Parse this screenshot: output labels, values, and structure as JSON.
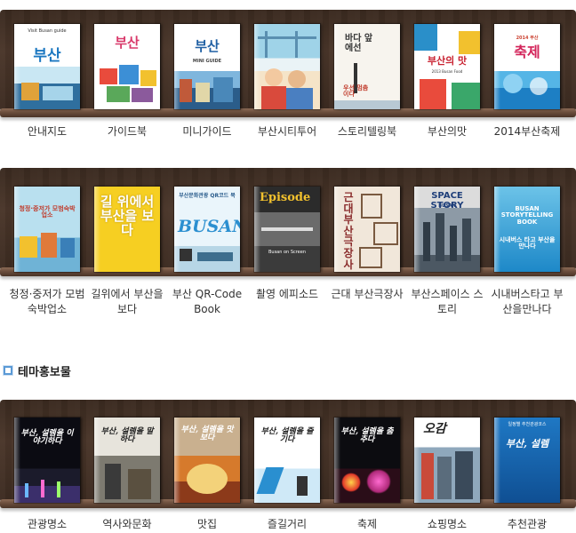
{
  "shelves": [
    {
      "books": [
        {
          "caption": "안내지도",
          "cover_title": "부산",
          "cover_small": "Visit Busan guide"
        },
        {
          "caption": "가이드북",
          "cover_title": "부산",
          "cover_small": "SOUL BUSAN"
        },
        {
          "caption": "미니가이드",
          "cover_title": "부산",
          "cover_small": "MINI GUIDE"
        },
        {
          "caption": "부산시티투어",
          "cover_title": "",
          "cover_small": ""
        },
        {
          "caption": "스토리텔링북",
          "cover_title": "바다 앞에선",
          "cover_small": "우선 멈춤이다"
        },
        {
          "caption": "부산의맛",
          "cover_title": "부산의 맛",
          "cover_small": "2013 Busan Food"
        },
        {
          "caption": "2014부산축제",
          "cover_title": "축제",
          "cover_small": "2014 부산"
        }
      ]
    },
    {
      "books": [
        {
          "caption": "청정·중저가 모범 숙박업소",
          "cover_title": "청정·중저가 모범숙박업소",
          "cover_small": ""
        },
        {
          "caption": "길위에서 부산을보다",
          "cover_title": "길 위에서 부산을 보다",
          "cover_small": ""
        },
        {
          "caption": "부산 QR-Code Book",
          "cover_title": "BUSAN",
          "cover_small": "부산문화관광 QR코드 북"
        },
        {
          "caption": "촬영 에피소드",
          "cover_title": "Episode",
          "cover_small": "Busan on Screen"
        },
        {
          "caption": "근대 부산극장사",
          "cover_title": "근대 부산극장사",
          "cover_small": ""
        },
        {
          "caption": "부산스페이스 스토리",
          "cover_title": "SPACE STORY",
          "cover_small": "BUSAN"
        },
        {
          "caption": "시내버스타고 부산을만나다",
          "cover_title": "BUSAN STORYTELLING BOOK",
          "cover_small": "시내버스 타고 부산을 만나다"
        }
      ]
    },
    {
      "books": [
        {
          "caption": "관광명소",
          "cover_title": "부산, 설렘을 이야기하다",
          "cover_small": ""
        },
        {
          "caption": "역사와문화",
          "cover_title": "부산, 설렘을 말하다",
          "cover_small": ""
        },
        {
          "caption": "맛집",
          "cover_title": "부산, 설렘을 맛보다",
          "cover_small": ""
        },
        {
          "caption": "즐길거리",
          "cover_title": "부산, 설렘을 즐기다",
          "cover_small": ""
        },
        {
          "caption": "축제",
          "cover_title": "부산, 설렘을 춤추다",
          "cover_small": ""
        },
        {
          "caption": "쇼핑명소",
          "cover_title": "오감",
          "cover_small": ""
        },
        {
          "caption": "추천관광",
          "cover_title": "부산, 설렘",
          "cover_small": "일정별 추천관광코스"
        }
      ]
    }
  ],
  "section": {
    "title": "테마홍보물"
  },
  "colors": {
    "shelf_wood": "#3e2c22",
    "section_bullet": "#5b9ad6",
    "caption_text": "#333333"
  }
}
